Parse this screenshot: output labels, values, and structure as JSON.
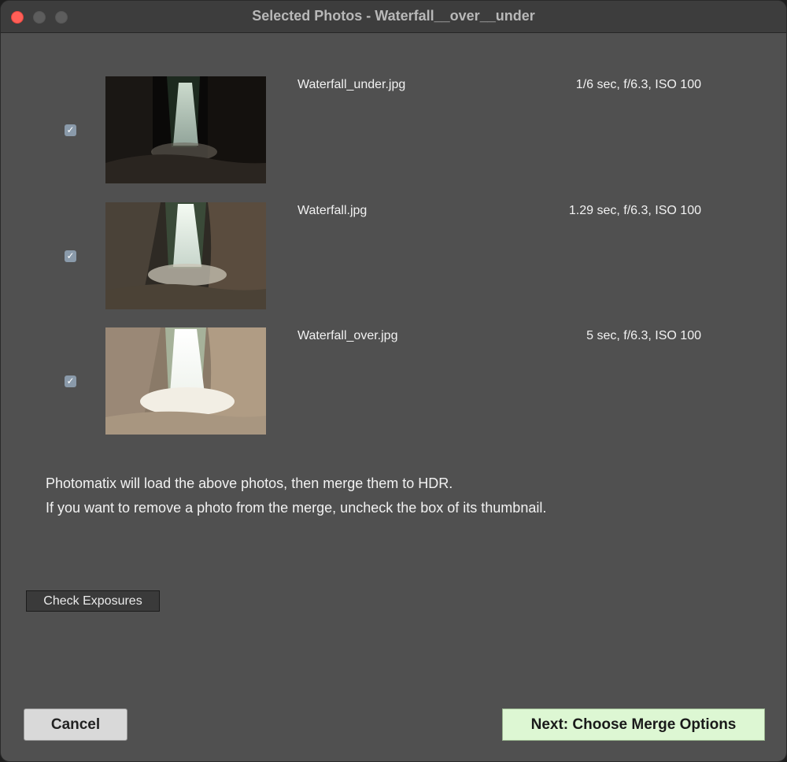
{
  "window": {
    "title": "Selected Photos - Waterfall__over__under"
  },
  "photos": [
    {
      "checked": true,
      "filename": "Waterfall_under.jpg",
      "exif": "1/6 sec, f/6.3, ISO 100",
      "thumbnail": "waterfall-under-exposed"
    },
    {
      "checked": true,
      "filename": "Waterfall.jpg",
      "exif": "1.29 sec, f/6.3, ISO 100",
      "thumbnail": "waterfall-normal-exposure"
    },
    {
      "checked": true,
      "filename": "Waterfall_over.jpg",
      "exif": "5 sec, f/6.3, ISO 100",
      "thumbnail": "waterfall-over-exposed"
    }
  ],
  "checkmark_glyph": "✓",
  "info": {
    "line1": "Photomatix will load the above photos, then merge them to HDR.",
    "line2": "If you want to remove a photo from the merge, uncheck the box of its thumbnail."
  },
  "buttons": {
    "check_exposures": "Check Exposures",
    "cancel": "Cancel",
    "next": "Next: Choose Merge Options"
  },
  "colors": {
    "next_button_bg": "#ddf7d3",
    "close_button": "#ff5f57",
    "window_bg": "#505050"
  }
}
